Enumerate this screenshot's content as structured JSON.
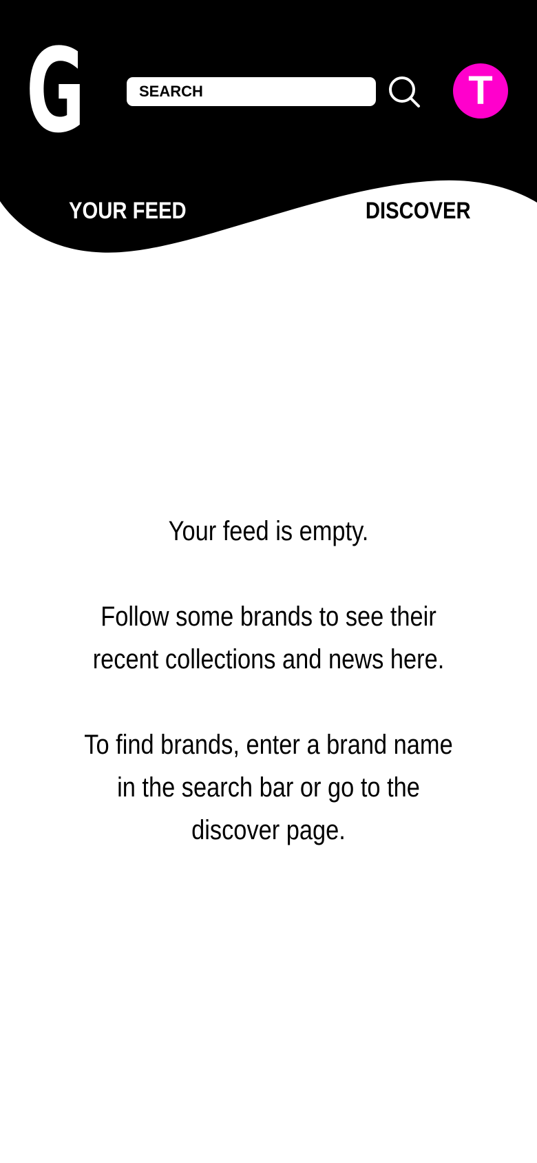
{
  "colors": {
    "header_background": "#000000",
    "avatar_background": "#ff00cc",
    "page_background": "#ffffff"
  },
  "header": {
    "logo_letter": "G",
    "search": {
      "placeholder": "SEARCH",
      "value": ""
    },
    "search_button_icon": "search-icon",
    "avatar_initial": "T"
  },
  "tabs": [
    {
      "label": "YOUR FEED",
      "active": true
    },
    {
      "label": "DISCOVER",
      "active": false
    }
  ],
  "empty_state": {
    "line1": "Your feed is empty.",
    "line2": "Follow some brands to see their recent collections and news here.",
    "line3": "To find brands, enter a brand name in the search bar or go to the discover page."
  }
}
